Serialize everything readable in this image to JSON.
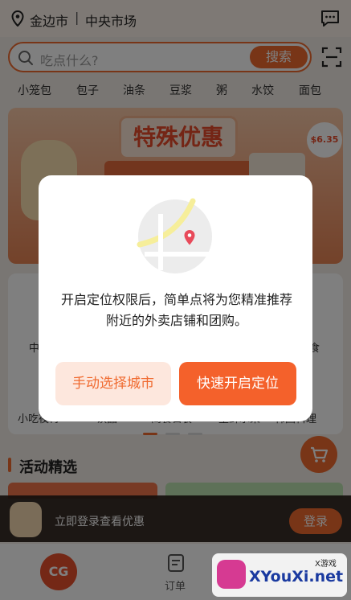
{
  "header": {
    "city": "金边市",
    "separator": "|",
    "market": "中央市场",
    "location_icon": "location-pin-icon",
    "message_icon": "chat-bubble-icon"
  },
  "search": {
    "placeholder": "吃点什么?",
    "button_label": "搜索",
    "scan_icon": "scan-icon"
  },
  "categories": [
    "小笼包",
    "包子",
    "油条",
    "豆浆",
    "粥",
    "水饺",
    "面包"
  ],
  "banner": {
    "title": "特殊优惠",
    "price_tag": "$6.35"
  },
  "quick_cards": {
    "visible_labels": [
      "小吃夜宵",
      "饮品",
      "简餐日食",
      "生鲜水果",
      "韩国料理"
    ],
    "peek_left": "中",
    "peek_right": "美食"
  },
  "section": {
    "title": "活动精选"
  },
  "login_bar": {
    "text": "立即登录查看优惠",
    "button_label": "登录"
  },
  "tabbar": {
    "home_label": "CG",
    "orders_label": "订单"
  },
  "watermark": {
    "top": "X游戏",
    "text": "XYouXi.net"
  },
  "dialog": {
    "message": "开启定位权限后，简单点将为您精准推荐附近的外卖店铺和团购。",
    "manual_button": "手动选择城市",
    "enable_button": "快速开启定位",
    "illustration_icon": "map-location-icon"
  },
  "colors": {
    "accent": "#f06a2f",
    "accent_light": "#fde7dd",
    "overlay": "rgba(0,0,0,0.5)"
  }
}
